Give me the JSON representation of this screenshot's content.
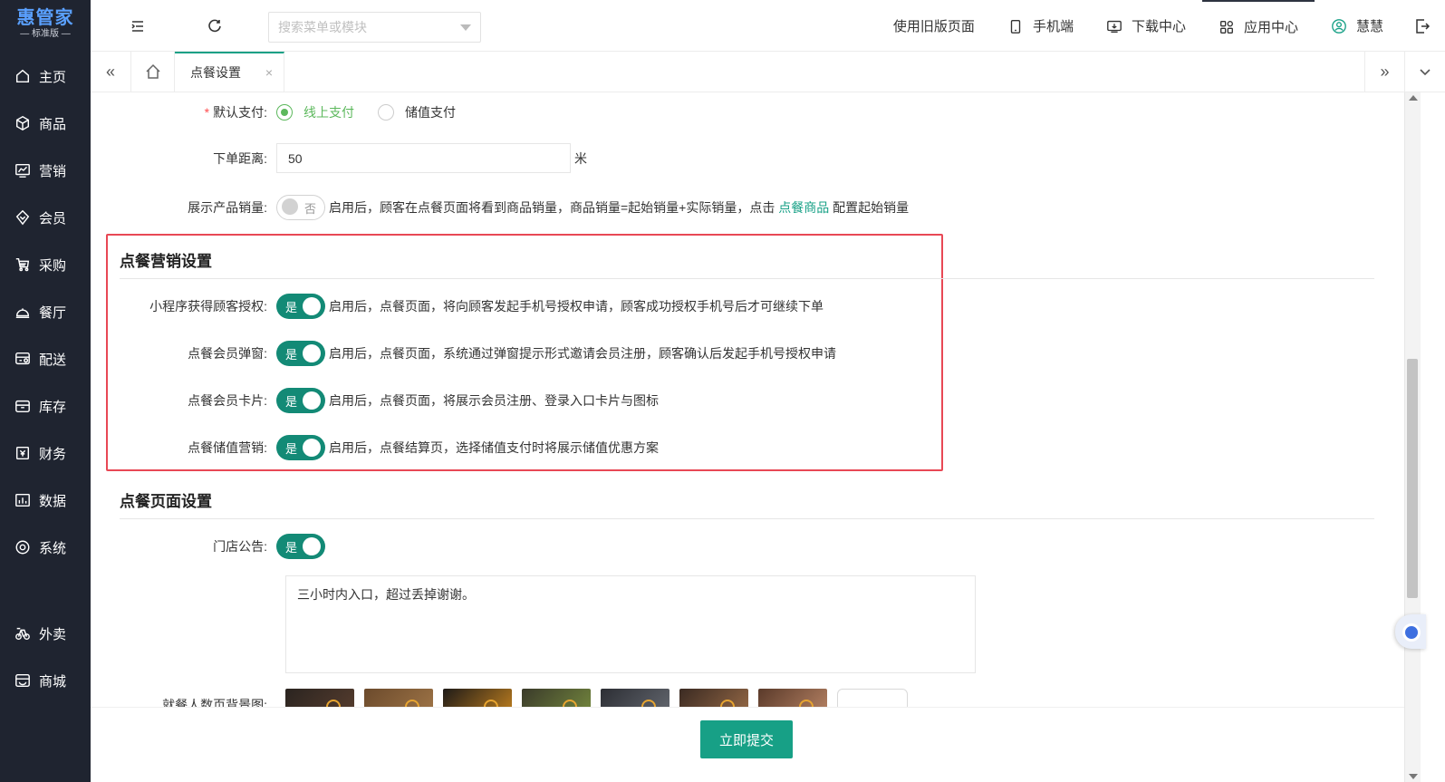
{
  "brand": {
    "name": "惠管家",
    "edition": "— 标准版 —",
    "color": "#5aa0ff"
  },
  "sidebar": {
    "items": [
      {
        "label": "主页",
        "icon": "home-icon"
      },
      {
        "label": "商品",
        "icon": "cube-icon"
      },
      {
        "label": "营销",
        "icon": "chart-icon"
      },
      {
        "label": "会员",
        "icon": "diamond-icon"
      },
      {
        "label": "采购",
        "icon": "cart-icon"
      },
      {
        "label": "餐厅",
        "icon": "dish-icon"
      },
      {
        "label": "配送",
        "icon": "truck-icon"
      },
      {
        "label": "库存",
        "icon": "box-icon"
      },
      {
        "label": "财务",
        "icon": "finance-icon"
      },
      {
        "label": "数据",
        "icon": "data-icon"
      },
      {
        "label": "系统",
        "icon": "system-icon"
      },
      {
        "label": "外卖",
        "icon": "bike-icon"
      },
      {
        "label": "商城",
        "icon": "store-icon"
      }
    ]
  },
  "topbar": {
    "search_placeholder": "搜索菜单或模块",
    "links": {
      "old_version": "使用旧版页面",
      "mobile": "手机端",
      "download": "下载中心",
      "apps": "应用中心",
      "user": "慧慧"
    }
  },
  "tabs": {
    "active": "点餐设置",
    "close": "×",
    "prev": "«",
    "next": "»"
  },
  "form": {
    "default_pay": {
      "required_mark": "*",
      "label": "默认支付:",
      "options": [
        "线上支付",
        "储值支付"
      ],
      "selected": "线上支付"
    },
    "distance": {
      "label": "下单距离:",
      "value": "50",
      "unit": "米"
    },
    "show_sales": {
      "label": "展示产品销量:",
      "state": "否",
      "desc_before": "启用后，顾客在点餐页面将看到商品销量，商品销量=起始销量+实际销量，点击",
      "link": "点餐商品",
      "desc_after": "配置起始销量"
    }
  },
  "marketing": {
    "title": "点餐营销设置",
    "items": [
      {
        "label": "小程序获得顾客授权:",
        "state": "是",
        "desc": "启用后，点餐页面，将向顾客发起手机号授权申请，顾客成功授权手机号后才可继续下单"
      },
      {
        "label": "点餐会员弹窗:",
        "state": "是",
        "desc": "启用后，点餐页面，系统通过弹窗提示形式邀请会员注册，顾客确认后发起手机号授权申请"
      },
      {
        "label": "点餐会员卡片:",
        "state": "是",
        "desc": "启用后，点餐页面，将展示会员注册、登录入口卡片与图标"
      },
      {
        "label": "点餐储值营销:",
        "state": "是",
        "desc": "启用后，点餐结算页，选择储值支付时将展示储值优惠方案"
      }
    ]
  },
  "page_settings": {
    "title": "点餐页面设置",
    "notice": {
      "label": "门店公告:",
      "state": "是",
      "text": "三小时内入口，超过丢掉谢谢。"
    },
    "background": {
      "label": "就餐人数页背景图:"
    }
  },
  "footer": {
    "submit": "立即提交"
  },
  "colors": {
    "accent": "#17a086",
    "switch_on": "#138a76",
    "highlight": "#e84855",
    "sidebar_bg": "#1f2430"
  }
}
